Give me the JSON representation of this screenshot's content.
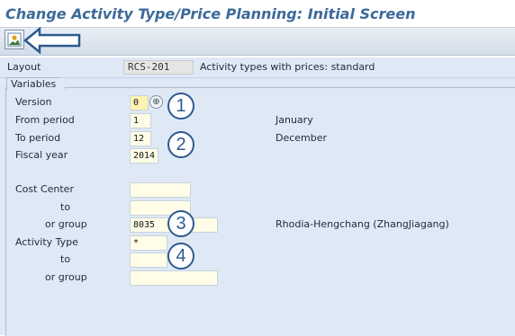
{
  "title": "Change Activity Type/Price Planning: Initial Screen",
  "toolbar": {
    "button_icon": "landscape-icon"
  },
  "layout": {
    "label": "Layout",
    "value": "RCS-201",
    "description": "Activity types with prices: standard"
  },
  "variables": {
    "tab_label": "Variables",
    "version": {
      "label": "Version",
      "value": "0"
    },
    "from_period": {
      "label": "From period",
      "value": "1",
      "description": "January"
    },
    "to_period": {
      "label": "To period",
      "value": "12",
      "description": "December"
    },
    "fiscal_year": {
      "label": "Fiscal year",
      "value": "2014"
    },
    "cost_center": {
      "label": "Cost Center",
      "value": "",
      "to_label": "to",
      "to_value": "",
      "group_label": "or group",
      "group_value": "8035",
      "group_description": "Rhodia-Hengchang (ZhangJiagang)"
    },
    "activity_type": {
      "label": "Activity Type",
      "value": "*",
      "to_label": "to",
      "to_value": "",
      "group_label": "or group",
      "group_value": ""
    }
  },
  "callouts": [
    "1",
    "2",
    "3",
    "4"
  ],
  "colors": {
    "title": "#3d6a9a",
    "panel": "#dfe9f5",
    "input": "#fffde8",
    "callout": "#2d5a8f"
  }
}
